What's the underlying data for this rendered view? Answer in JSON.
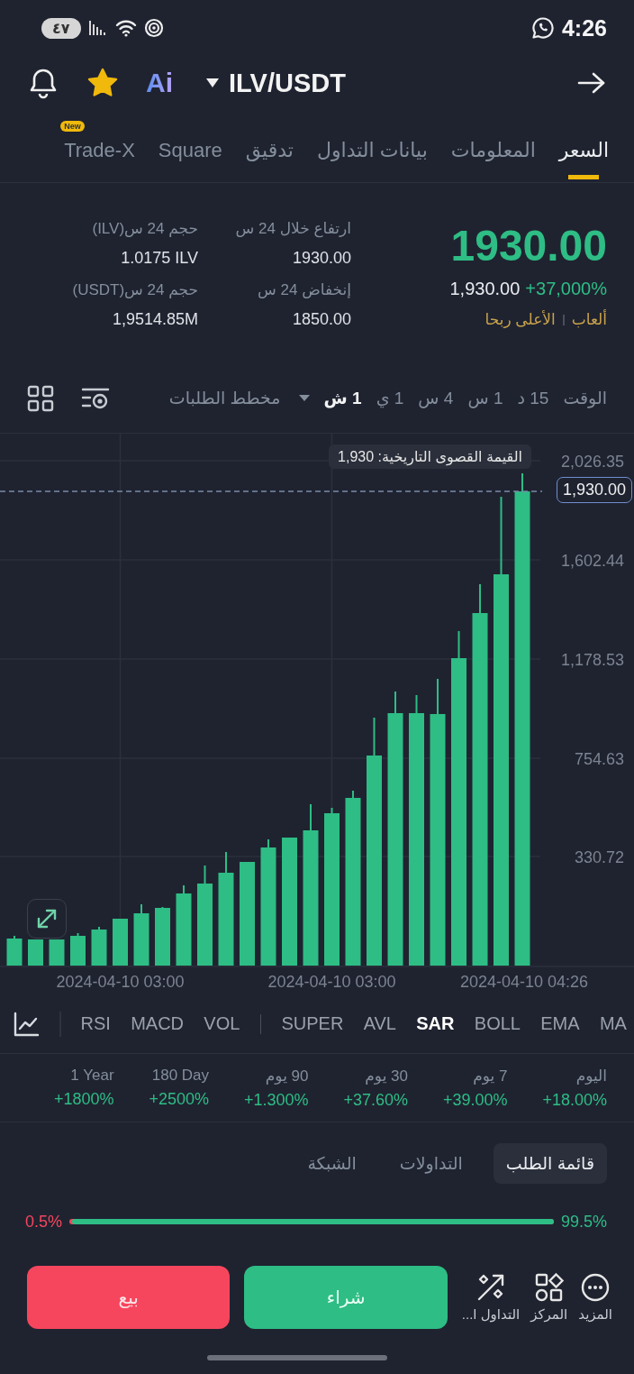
{
  "status_bar": {
    "battery": "٤٧",
    "time": "4:26"
  },
  "header": {
    "favorited": true,
    "ai_label": "Ai",
    "pair": "ILV/USDT"
  },
  "tabs": [
    {
      "label": "السعر",
      "selected": true
    },
    {
      "label": "المعلومات",
      "selected": false
    },
    {
      "label": "بيانات التداول",
      "selected": false
    },
    {
      "label": "تدقيق",
      "selected": false
    },
    {
      "label": "Square",
      "selected": false
    },
    {
      "label": "Trade-X",
      "selected": false,
      "badge": "New"
    }
  ],
  "price": {
    "last": "1930.00",
    "converted": "1,930.00",
    "change": "+37,000%",
    "tags": [
      "ألعاب",
      "الأعلى ربحا"
    ]
  },
  "stats": [
    {
      "label": "ارتفاع خلال 24 س",
      "value": "1930.00"
    },
    {
      "label": "حجم 24 س(ILV)",
      "value": "1.0175 ILV"
    },
    {
      "label": "إنخفاض 24 س",
      "value": "1850.00"
    },
    {
      "label": "حجم 24 س(USDT)",
      "value": "1,9514.85M"
    }
  ],
  "timeframes": {
    "label": "الوقت",
    "options": [
      {
        "label": "15 د",
        "selected": false
      },
      {
        "label": "1 س",
        "selected": false
      },
      {
        "label": "4 س",
        "selected": false
      },
      {
        "label": "1 ي",
        "selected": false
      },
      {
        "label": "1 ش",
        "selected": true
      }
    ],
    "depth_label": "مخطط الطلبات"
  },
  "chart": {
    "ath_tooltip": "القيمة القصوى التاريخية: 1,930",
    "price_tag": "1,930.00",
    "price_axis": [
      "2,026.35",
      "1,602.44",
      "1,178.53",
      "754.63",
      "330.72"
    ],
    "time_axis": [
      "2024-04-10 04:26",
      "2024-04-10 03:00",
      "2024-04-10 03:00"
    ]
  },
  "indicators": [
    {
      "label": "MA",
      "selected": false
    },
    {
      "label": "EMA",
      "selected": false
    },
    {
      "label": "BOLL",
      "selected": false
    },
    {
      "label": "SAR",
      "selected": true
    },
    {
      "label": "AVL",
      "selected": false
    },
    {
      "label": "SUPER",
      "selected": false
    },
    {
      "label": "VOL",
      "selected": false
    },
    {
      "label": "MACD",
      "selected": false
    },
    {
      "label": "RSI",
      "selected": false
    }
  ],
  "performance": [
    {
      "period": "اليوم",
      "change": "+18.00%"
    },
    {
      "period": "7 يوم",
      "change": "+39.00%"
    },
    {
      "period": "30 يوم",
      "change": "+37.60%"
    },
    {
      "period": "90 يوم",
      "change": "+1.300%"
    },
    {
      "period": "180 Day",
      "change": "+2500%"
    },
    {
      "period": "1 Year",
      "change": "+1800%"
    }
  ],
  "book_tabs": [
    {
      "label": "قائمة الطلب",
      "selected": true
    },
    {
      "label": "التداولات",
      "selected": false
    },
    {
      "label": "الشبكة",
      "selected": false
    }
  ],
  "ratio": {
    "sell": "0.5%",
    "buy": "99.5%",
    "level": 0.995
  },
  "bottom_bar": {
    "actions": [
      {
        "kind": "more",
        "label": "المزيد"
      },
      {
        "kind": "position",
        "label": "المركز"
      },
      {
        "kind": "trade",
        "label": "التداول ا..."
      }
    ],
    "buttons": [
      {
        "kind": "buy",
        "label": "شراء"
      },
      {
        "kind": "sell",
        "label": "بيع"
      }
    ]
  }
}
